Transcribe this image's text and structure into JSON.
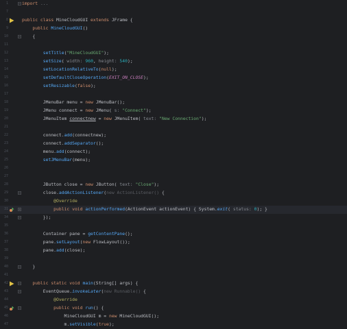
{
  "editor": {
    "lines": [
      {
        "n": "1",
        "code": "import ..."
      },
      {
        "n": "7",
        "code": ""
      },
      {
        "n": "8",
        "code": "public class MineCloudGUI extends JFrame {"
      },
      {
        "n": "9",
        "code": "    public MineCloudGUI()"
      },
      {
        "n": "10",
        "code": "    {"
      },
      {
        "n": "11",
        "code": ""
      },
      {
        "n": "12",
        "code": "        setTitle(\"MineCloudGUI\");"
      },
      {
        "n": "13",
        "code": "        setSize( width: 960, height: 540);"
      },
      {
        "n": "14",
        "code": "        setLocationRelativeTo(null);"
      },
      {
        "n": "15",
        "code": "        setDefaultCloseOperation(EXIT_ON_CLOSE);"
      },
      {
        "n": "16",
        "code": "        setResizable(false);"
      },
      {
        "n": "17",
        "code": ""
      },
      {
        "n": "18",
        "code": "        JMenuBar menu = new JMenuBar();"
      },
      {
        "n": "19",
        "code": "        JMenu connect = new JMenu( s: \"Connect\");"
      },
      {
        "n": "20",
        "code": "        JMenuItem connectnew = new JMenuItem( text: \"New Connection\");"
      },
      {
        "n": "21",
        "code": ""
      },
      {
        "n": "22",
        "code": "        connect.add(connectnew);"
      },
      {
        "n": "23",
        "code": "        connect.addSeparator();"
      },
      {
        "n": "24",
        "code": "        menu.add(connect);"
      },
      {
        "n": "25",
        "code": "        setJMenuBar(menu);"
      },
      {
        "n": "26",
        "code": ""
      },
      {
        "n": "27",
        "code": ""
      },
      {
        "n": "28",
        "code": "        JButton close = new JButton( text: \"Close\");"
      },
      {
        "n": "29",
        "code": "        close.addActionListener(new ActionListener() {"
      },
      {
        "n": "30",
        "code": "            @Override"
      },
      {
        "n": "31",
        "code": "            public void actionPerformed(ActionEvent actionEvent) { System.exit( status: 0); }"
      },
      {
        "n": "34",
        "code": "        });"
      },
      {
        "n": "35",
        "code": ""
      },
      {
        "n": "36",
        "code": "        Container pane = getContentPane();"
      },
      {
        "n": "37",
        "code": "        pane.setLayout(new FlowLayout());"
      },
      {
        "n": "38",
        "code": "        pane.add(close);"
      },
      {
        "n": "39",
        "code": ""
      },
      {
        "n": "40",
        "code": "    }"
      },
      {
        "n": "41",
        "code": ""
      },
      {
        "n": "42",
        "code": "    public static void main(String[] args) {"
      },
      {
        "n": "43",
        "code": "        EventQueue.invokeLater(new Runnable() {"
      },
      {
        "n": "44",
        "code": "            @Override"
      },
      {
        "n": "45",
        "code": "            public void run() {"
      },
      {
        "n": "46",
        "code": "                MineCloudGUI m = new MineCloudGUI();"
      },
      {
        "n": "47",
        "code": "                m.setVisible(true);"
      },
      {
        "n": "48",
        "code": "            }"
      },
      {
        "n": "49",
        "code": "        });"
      }
    ],
    "colors": {
      "background": "#1e1f22",
      "keyword": "#cf8e6d",
      "string": "#6aab73",
      "method": "#56a8f5",
      "annotation": "#b3ae60",
      "run_icon": "#5fb865",
      "override_icon": "#e08855"
    },
    "icons": {
      "run": "run-gutter-icon",
      "override": "override-gutter-icon",
      "fold": "fold-marker-icon"
    }
  }
}
